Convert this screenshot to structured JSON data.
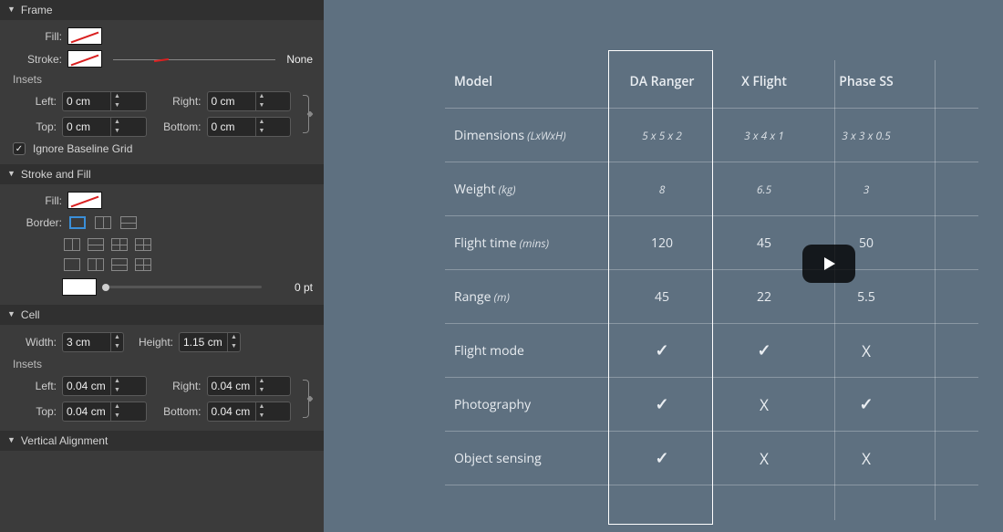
{
  "panel": {
    "frame": {
      "title": "Frame",
      "fill_label": "Fill:",
      "stroke_label": "Stroke:",
      "stroke_style": "None",
      "insets_label": "Insets",
      "left_label": "Left:",
      "right_label": "Right:",
      "top_label": "Top:",
      "bottom_label": "Bottom:",
      "left_value": "0 cm",
      "right_value": "0 cm",
      "top_value": "0 cm",
      "bottom_value": "0 cm",
      "ignore_baseline_label": "Ignore Baseline Grid",
      "ignore_baseline_checked": true
    },
    "stroke_fill": {
      "title": "Stroke and Fill",
      "fill_label": "Fill:",
      "border_label": "Border:",
      "stroke_weight": "0 pt"
    },
    "cell": {
      "title": "Cell",
      "width_label": "Width:",
      "height_label": "Height:",
      "width_value": "3 cm",
      "height_value": "1.15 cm",
      "insets_label": "Insets",
      "left_label": "Left:",
      "right_label": "Right:",
      "top_label": "Top:",
      "bottom_label": "Bottom:",
      "left_value": "0.04 cm",
      "right_value": "0.04 cm",
      "top_value": "0.04 cm",
      "bottom_value": "0.04 cm"
    },
    "vertical_alignment": {
      "title": "Vertical Alignment"
    }
  },
  "table": {
    "headers": {
      "label": "Model",
      "c1": "DA Ranger",
      "c2": "X Flight",
      "c3": "Phase SS"
    },
    "rows": [
      {
        "label": "Dimensions",
        "sublabel": "(LxWxH)",
        "c1": "5 x 5 x 2",
        "c2": "3 x 4 x 1",
        "c3": "3 x 3 x 0.5",
        "italic": true
      },
      {
        "label": "Weight",
        "sublabel": "(kg)",
        "c1": "8",
        "c2": "6.5",
        "c3": "3",
        "italic": true
      },
      {
        "label": "Flight time",
        "sublabel": "(mins)",
        "c1": "120",
        "c2": "45",
        "c3": "50"
      },
      {
        "label": "Range",
        "sublabel": "(m)",
        "c1": "45",
        "c2": "22",
        "c3": "5.5"
      },
      {
        "label": "Flight mode",
        "c1": "✓",
        "c2": "✓",
        "c3": "X",
        "sym": true
      },
      {
        "label": "Photography",
        "c1": "✓",
        "c2": "X",
        "c3": "✓",
        "sym": true
      },
      {
        "label": "Object sensing",
        "c1": "✓",
        "c2": "X",
        "c3": "X",
        "sym": true
      }
    ]
  },
  "icons": {
    "check": "✓",
    "x": "X"
  }
}
